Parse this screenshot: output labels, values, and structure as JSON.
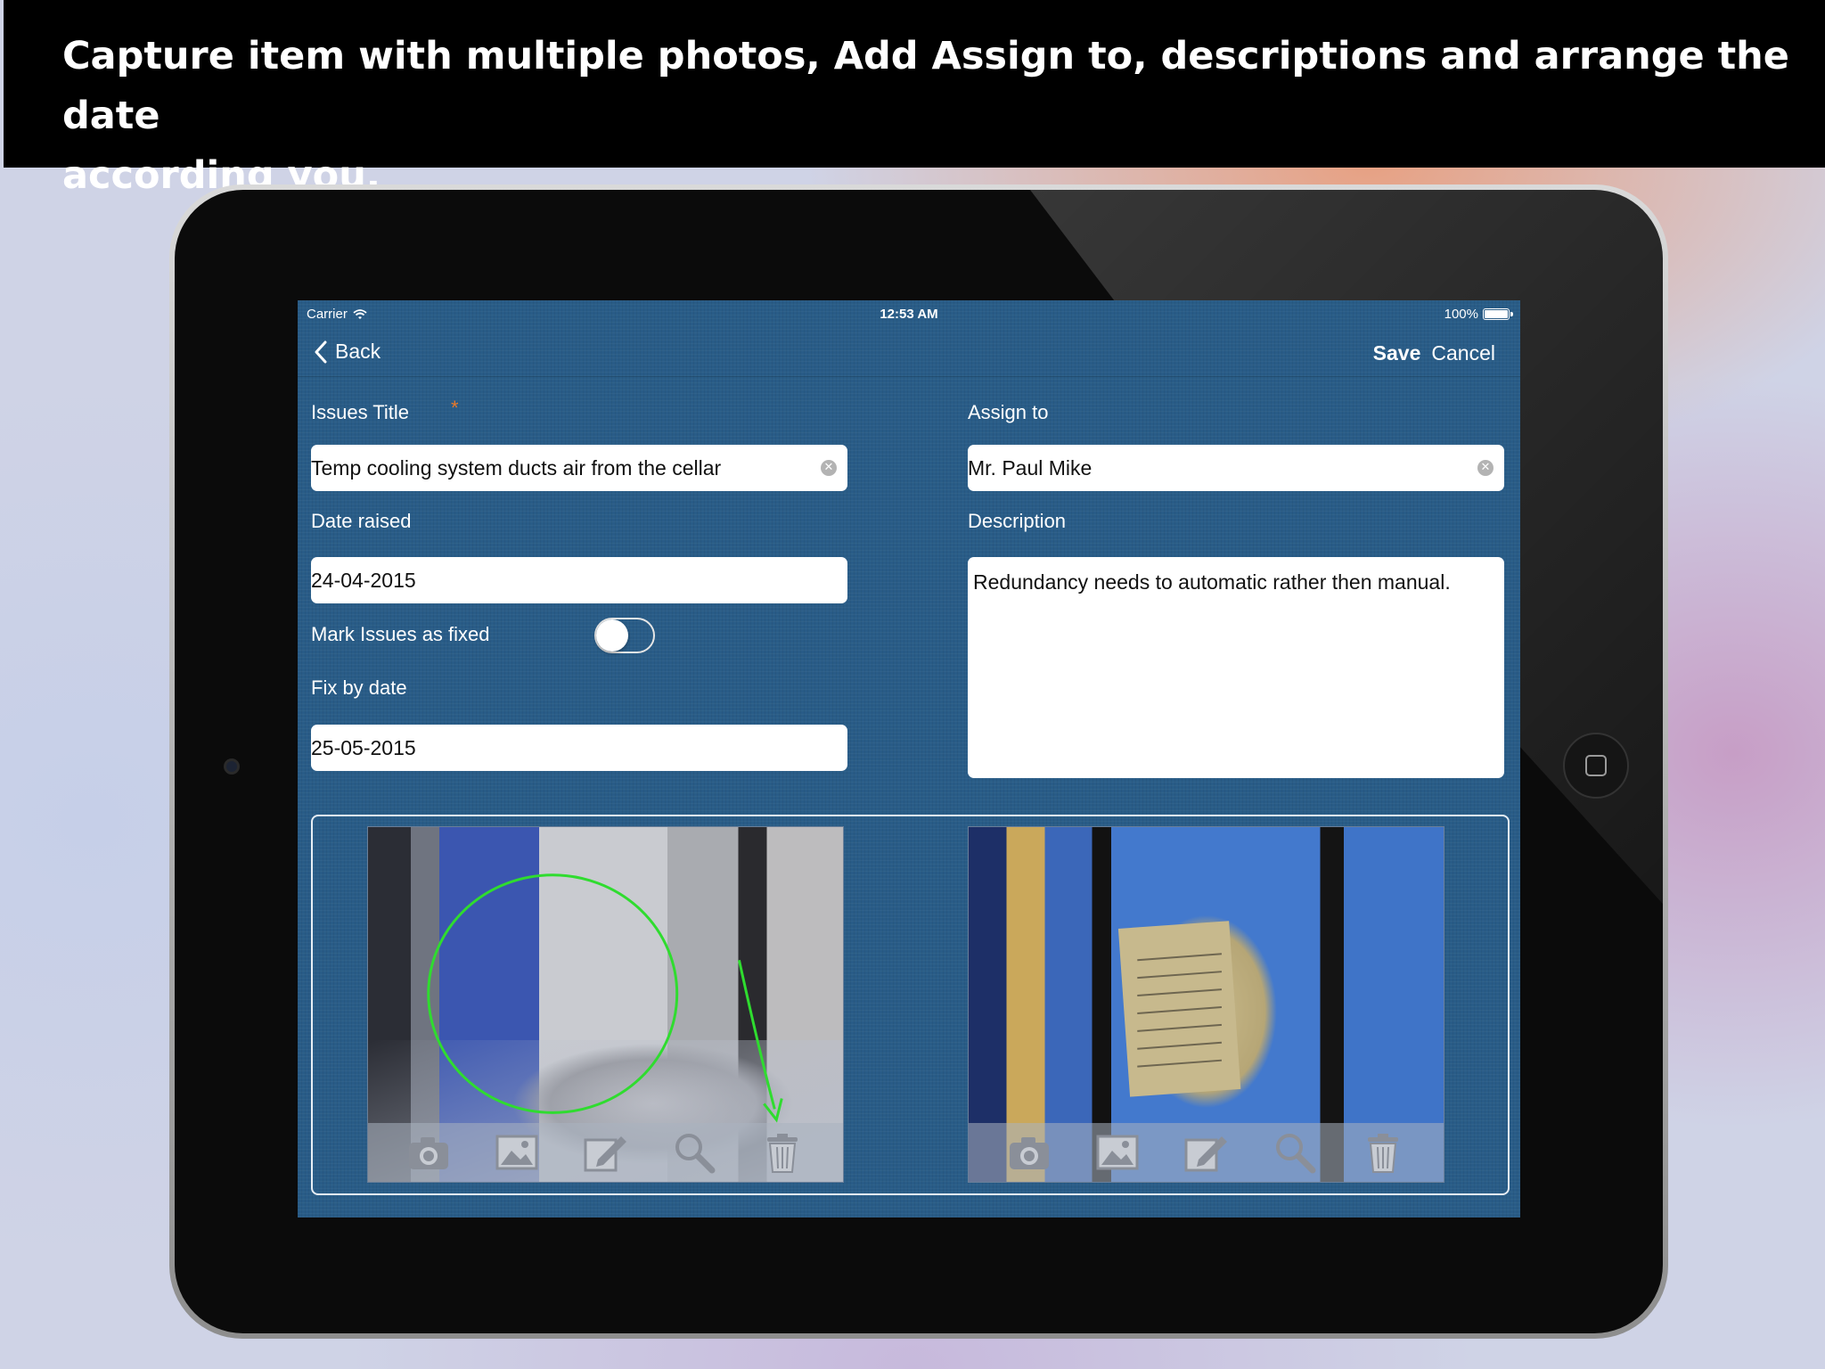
{
  "banner": {
    "line1": "Capture item with multiple photos, Add Assign to, descriptions and arrange the date",
    "line2": "according you."
  },
  "status_bar": {
    "carrier": "Carrier",
    "time": "12:53 AM",
    "battery": "100%"
  },
  "nav": {
    "back_label": "Back",
    "save_label": "Save",
    "cancel_label": "Cancel"
  },
  "form": {
    "issues_title_label": "Issues Title",
    "required_mark": "*",
    "issues_title_value": "Temp cooling system ducts air from the cellar",
    "assign_to_label": "Assign to",
    "assign_to_value": "Mr. Paul Mike",
    "date_raised_label": "Date raised",
    "date_raised_value": "24-04-2015",
    "description_label": "Description",
    "description_value": "Redundancy needs to automatic rather then manual.",
    "mark_fixed_label": "Mark Issues as fixed",
    "mark_fixed_on": false,
    "fix_by_label": "Fix by date",
    "fix_by_value": "25-05-2015"
  },
  "photos": [
    {
      "tools": [
        "camera-icon",
        "gallery-icon",
        "edit-icon",
        "zoom-icon",
        "trash-icon"
      ]
    },
    {
      "tools": [
        "camera-icon",
        "gallery-icon",
        "edit-icon",
        "zoom-icon",
        "trash-icon"
      ]
    }
  ],
  "colors": {
    "screen_bg": "#295c87",
    "required": "#e8792a",
    "annotation": "#2fdc2f"
  }
}
